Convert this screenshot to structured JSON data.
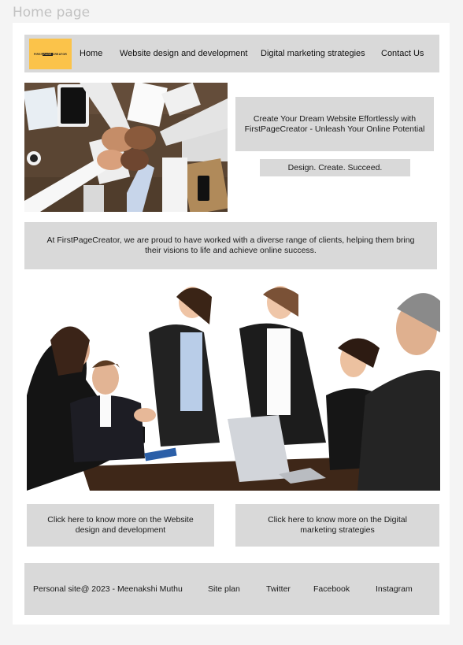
{
  "page": {
    "label": "Home page"
  },
  "nav": {
    "logo_text_left": "FIRST",
    "logo_text_mid": "PAGE",
    "logo_text_right": "CREATOR",
    "items": [
      "Home",
      "Website design and development",
      "Digital marketing strategies",
      "Contact Us"
    ]
  },
  "hero": {
    "title": "Create Your Dream Website Effortlessly with FirstPageCreator - Unleash Your Online Potential",
    "tagline": "Design. Create. Succeed."
  },
  "about": {
    "text": "At FirstPageCreator, we are proud to have worked with a diverse range of clients, helping them bring their visions to life and achieve online success."
  },
  "cta": {
    "web": "Click here to know more on the Website design and development",
    "dm": "Click here to know more on the Digital marketing strategies"
  },
  "footer": {
    "copyright": "Personal site@ 2023 - Meenakshi Muthu",
    "links": [
      "Site plan",
      "Twitter",
      "Facebook",
      "Instagram"
    ]
  },
  "colors": {
    "panel": "#d9d9d9",
    "logo_bg": "#fbc34a",
    "canvas": "#f4f4f4"
  }
}
